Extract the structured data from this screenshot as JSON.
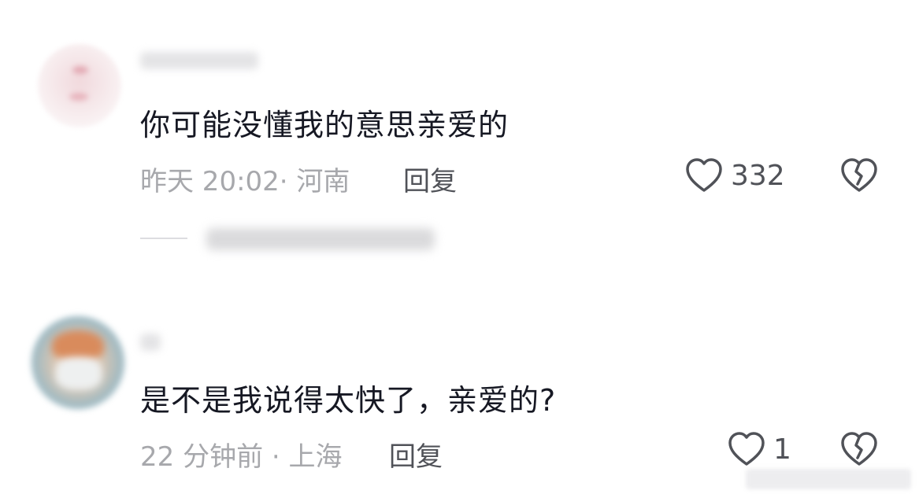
{
  "comments": [
    {
      "text": "你可能没懂我的意思亲爱的",
      "meta": "昨天 20:02· 河南",
      "reply_label": "回复",
      "likes": "332"
    },
    {
      "text": "是不是我说得太快了，亲爱的?",
      "meta": "22 分钟前 · 上海",
      "reply_label": "回复",
      "likes": "1"
    }
  ],
  "icons": {
    "like": "heart-outline-icon",
    "dislike": "broken-heart-icon"
  },
  "colors": {
    "text": "#161823",
    "meta": "#a7a8ac",
    "action": "#505258"
  }
}
